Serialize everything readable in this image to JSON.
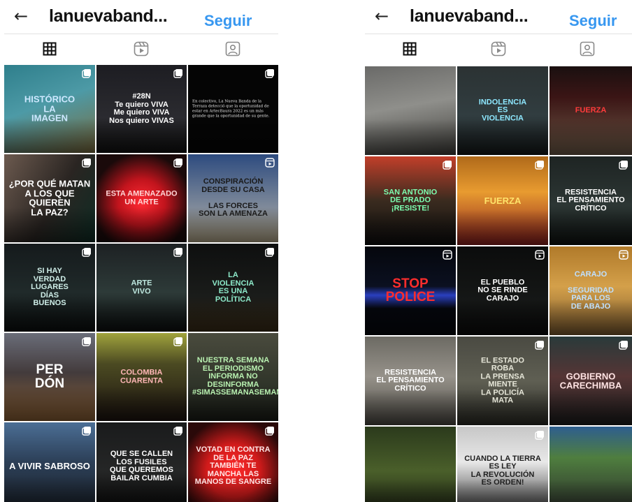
{
  "left": {
    "header": {
      "username": "lanuevaband...",
      "follow": "Seguir"
    },
    "tabs": [
      {
        "name": "grid"
      },
      {
        "name": "reels"
      },
      {
        "name": "tagged"
      }
    ],
    "posts": [
      {
        "text": "HISTÓRICO\nLA\nIMAGEN",
        "bg": "linear-gradient(160deg,#2f7f8c 0%,#4d9aa6 45%,#7a6b3d 100%)",
        "fg": "#cde8ff",
        "size": "med",
        "badge": "multi"
      },
      {
        "text": "#28N\nTe quiero VIVA\nMe quiero VIVA\nNos quiero VIVAS",
        "bg": "linear-gradient(180deg,#1d1d22 0%,#2b2b30 60%,#111 100%)",
        "fg": "#ffffff",
        "size": "",
        "badge": "multi"
      },
      {
        "text": "En colectivo, La Nueva Banda de la Terraza detecció que la oportunidad de estar en ArtecBaura 2022 es un más grande que la oportunidad de su gente.",
        "bg": "#050505",
        "fg": "#e8e8e8",
        "size": "small",
        "badge": "multi"
      },
      {
        "text": "¿POR QUÉ MATAN\nA LOS QUE QUIEREN\nLA PAZ?",
        "bg": "linear-gradient(120deg,#6c5a4f 0%,#2a2522 55%,#0e2c24 100%)",
        "fg": "#ffffff",
        "size": "med",
        "badge": "multi"
      },
      {
        "text": "ESTA AMENAZADO UN ARTE",
        "bg": "radial-gradient(circle at 50% 55%,#ff2a33 0%,#c2141d 35%,#1a0a0a 75%)",
        "fg": "#ffd6d6",
        "size": "",
        "badge": "multi"
      },
      {
        "text": "CONSPIRACIÓN\nDESDE SU CASA\n\nLAS FORCES\nSON LA AMENAZA",
        "bg": "linear-gradient(180deg,#2d4b7f 0%,#7f8a9a 60%,#b5a88a 100%)",
        "fg": "#1a1a1a",
        "size": "",
        "badge": "reel"
      },
      {
        "text": "SI HAY\nVERDAD\nLUGARES\nDÍAS\nBUENOS",
        "bg": "linear-gradient(180deg,#151a1c 0%,#202a2a 55%,#0b0e0e 100%)",
        "fg": "#cfeee8",
        "size": "",
        "badge": "multi"
      },
      {
        "text": "ARTE\nVIVO",
        "bg": "linear-gradient(180deg,#1d2123 0%,#2d3a38 55%,#0c0f0f 100%)",
        "fg": "#bfe9e0",
        "size": "",
        "badge": "multi"
      },
      {
        "text": "LA\nVIOLENCIA\nES UNA\nPOLÍTICA",
        "bg": "linear-gradient(180deg,#0e0f0f 0%,#1a1c1a 60%,#3a2c17 100%)",
        "fg": "#8de9c9",
        "size": "",
        "badge": "multi"
      },
      {
        "text": "PER\nDÓN",
        "bg": "linear-gradient(180deg,#6a6d79 0%,#433b3c 45%,#8a5f34 100%)",
        "fg": "#ffffff",
        "size": "big",
        "badge": "multi"
      },
      {
        "text": "COLOMBIA\nCUARENTA",
        "bg": "linear-gradient(180deg,#a1a33d 0%,#4b4a22 35%,#1c130f 100%)",
        "fg": "#ffb7b7",
        "size": "",
        "badge": "multi"
      },
      {
        "text": "NUESTRA SEMANA\nEL PERIODISMO INFORMA NO\nDESINFORMA\n#SIMASSEMANASEMANA",
        "bg": "linear-gradient(180deg,#4a4b3e 0%,#2f3429 60%,#1a1c17 100%)",
        "fg": "#b8f0b0",
        "size": "",
        "badge": ""
      },
      {
        "text": "A VIVIR SABROSO",
        "bg": "linear-gradient(180deg,#4b6e95 0%,#2c3f57 45%,#1b222b 100%)",
        "fg": "#ffffff",
        "size": "med",
        "badge": "multi"
      },
      {
        "text": "QUE SE CALLEN\nLOS FUSILES\nQUE QUEREMOS\nBAILAR CUMBIA",
        "bg": "linear-gradient(180deg,#1a1b1c 0%,#252626 55%,#0b0b0b 100%)",
        "fg": "#ffffff",
        "size": "",
        "badge": "multi"
      },
      {
        "text": "VOTAD EN CONTRA DE LA PAZ\nTAMBIÉN TE MANCHA LAS\nMANOS DE SANGRE",
        "bg": "radial-gradient(circle at 50% 55%,#ff2a2a 0%,#d11b1b 40%,#2a0909 80%)",
        "fg": "#ffe6e6",
        "size": "",
        "badge": "multi"
      }
    ]
  },
  "right": {
    "header": {
      "username": "lanuevaband...",
      "follow": "Seguir"
    },
    "tabs": [
      {
        "name": "grid"
      },
      {
        "name": "reels"
      },
      {
        "name": "tagged"
      }
    ],
    "posts": [
      {
        "text": "",
        "bg": "linear-gradient(170deg,#6a6a68 0%,#8f8f8b 45%,#3f3e3a 100%)",
        "fg": "#ffffff",
        "size": "",
        "badge": ""
      },
      {
        "text": "INDOLENCIA\nES\nVIOLENCIA",
        "bg": "linear-gradient(180deg,#2b3233 0%,#313d40 55%,#141819 100%)",
        "fg": "#8ee8ff",
        "size": "",
        "badge": ""
      },
      {
        "text": "FUERZA",
        "bg": "linear-gradient(180deg,#1a1010 0%,#3b1515 35%,#6d5a47 100%)",
        "fg": "#ff3b3b",
        "size": "",
        "badge": ""
      },
      {
        "text": "SAN ANTONIO\nDE PRADO\n¡RESISTE!",
        "bg": "linear-gradient(180deg,#c23f2a 0%,#3a2b1f 50%,#0d0d0d 100%)",
        "fg": "#7dffb1",
        "size": "",
        "badge": "multi"
      },
      {
        "text": "FUERZA",
        "bg": "linear-gradient(180deg,#b06a1a 0%,#e89b30 40%,#8a1e1e 100%)",
        "fg": "#ffe36b",
        "size": "med",
        "badge": "multi"
      },
      {
        "text": "RESISTENCIA\nEL PENSAMIENTO\nCRÍTICO",
        "bg": "linear-gradient(180deg,#1e2423 0%,#2c3634 55%,#0e1110 100%)",
        "fg": "#ffffff",
        "size": "",
        "badge": "multi"
      },
      {
        "text": "STOP\nPOLICE",
        "bg": "linear-gradient(180deg,#05070d 0%,#0b1020 45%,#2a3fbf 55%,#05070d 70%)",
        "fg": "#ff2d2d",
        "size": "big",
        "badge": "reel"
      },
      {
        "text": "EL PUEBLO\nNO SE RINDE\nCARAJO",
        "bg": "linear-gradient(180deg,#0b0c0c 0%,#151716 60%,#0a0a0a 100%)",
        "fg": "#ffffff",
        "size": "",
        "badge": "reel"
      },
      {
        "text": "CARAJO\n\nSEGURIDAD\nPARA LOS\nDE ABAJO",
        "bg": "linear-gradient(180deg,#b07a2a 0%,#d4a04a 45%,#7b5a2e 100%)",
        "fg": "#bfe0ff",
        "size": "",
        "badge": "reel"
      },
      {
        "text": "RESISTENCIA\nEL PENSAMIENTO\nCRÍTICO",
        "bg": "linear-gradient(180deg,#6c6a63 0%,#96928a 45%,#4b4842 100%)",
        "fg": "#ffffff",
        "size": "",
        "badge": ""
      },
      {
        "text": "EL ESTADO\nROBA\nLA PRENSA\nMIENTE\nLA POLICÍA\nMATA",
        "bg": "linear-gradient(180deg,#4a4a42 0%,#5f5f53 50%,#2a2a24 100%)",
        "fg": "#e6e6d8",
        "size": "",
        "badge": "multi"
      },
      {
        "text": "GOBIERNO\nCARECHIMBA",
        "bg": "linear-gradient(180deg,#2a3a3a 0%,#553535 45%,#1c1c1c 100%)",
        "fg": "#ffe3e3",
        "size": "med",
        "badge": "multi"
      },
      {
        "text": "",
        "bg": "linear-gradient(180deg,#2b3a1c 0%,#4a5f2a 50%,#1a1f12 100%)",
        "fg": "#ffffff",
        "size": "",
        "badge": ""
      },
      {
        "text": "CUANDO LA TIERRA\nES LEY\nLA REVOLUCIÓN\nES ORDEN!",
        "bg": "linear-gradient(180deg,#c7c7c7 0%,#e8e8e8 40%,#2b2b2b 100%)",
        "fg": "#1e1e1e",
        "size": "",
        "badge": "multi"
      },
      {
        "text": "",
        "bg": "linear-gradient(180deg,#2e5e8f 0%,#4f7e3f 35%,#2a2a2a 100%)",
        "fg": "#ffffff",
        "size": "",
        "badge": ""
      }
    ]
  }
}
